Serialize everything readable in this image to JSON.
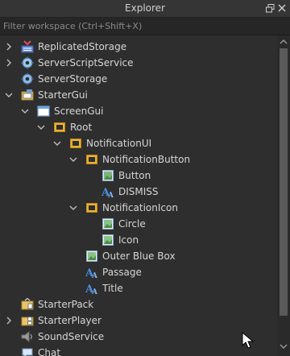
{
  "window": {
    "title": "Explorer"
  },
  "filter": {
    "placeholder": "Filter workspace (Ctrl+Shift+X)"
  },
  "tree": {
    "rows": [
      {
        "label": "ReplicatedStorage",
        "icon": "replicated-storage-icon",
        "expander": "collapsed"
      },
      {
        "label": "ServerScriptService",
        "icon": "server-script-service-icon",
        "expander": "collapsed"
      },
      {
        "label": "ServerStorage",
        "icon": "server-storage-icon",
        "expander": "none"
      },
      {
        "label": "StarterGui",
        "icon": "starter-gui-icon",
        "expander": "expanded"
      },
      {
        "label": "ScreenGui",
        "icon": "screen-gui-icon",
        "expander": "expanded"
      },
      {
        "label": "Root",
        "icon": "frame-icon",
        "expander": "expanded"
      },
      {
        "label": "NotificationUI",
        "icon": "frame-icon",
        "expander": "expanded"
      },
      {
        "label": "NotificationButton",
        "icon": "frame-icon",
        "expander": "expanded"
      },
      {
        "label": "Button",
        "icon": "image-button-icon",
        "expander": "none"
      },
      {
        "label": "DISMISS",
        "icon": "text-label-icon",
        "expander": "none"
      },
      {
        "label": "NotificationIcon",
        "icon": "frame-icon",
        "expander": "expanded"
      },
      {
        "label": "Circle",
        "icon": "image-label-icon",
        "expander": "none"
      },
      {
        "label": "Icon",
        "icon": "image-label-icon",
        "expander": "none"
      },
      {
        "label": "Outer Blue Box",
        "icon": "image-label-icon",
        "expander": "none"
      },
      {
        "label": "Passage",
        "icon": "text-label-icon",
        "expander": "none"
      },
      {
        "label": "Title",
        "icon": "text-label-icon",
        "expander": "none"
      },
      {
        "label": "StarterPack",
        "icon": "starter-pack-icon",
        "expander": "none"
      },
      {
        "label": "StarterPlayer",
        "icon": "starter-player-icon",
        "expander": "collapsed"
      },
      {
        "label": "SoundService",
        "icon": "sound-service-icon",
        "expander": "none"
      },
      {
        "label": "Chat",
        "icon": "chat-icon",
        "expander": "none"
      }
    ]
  }
}
